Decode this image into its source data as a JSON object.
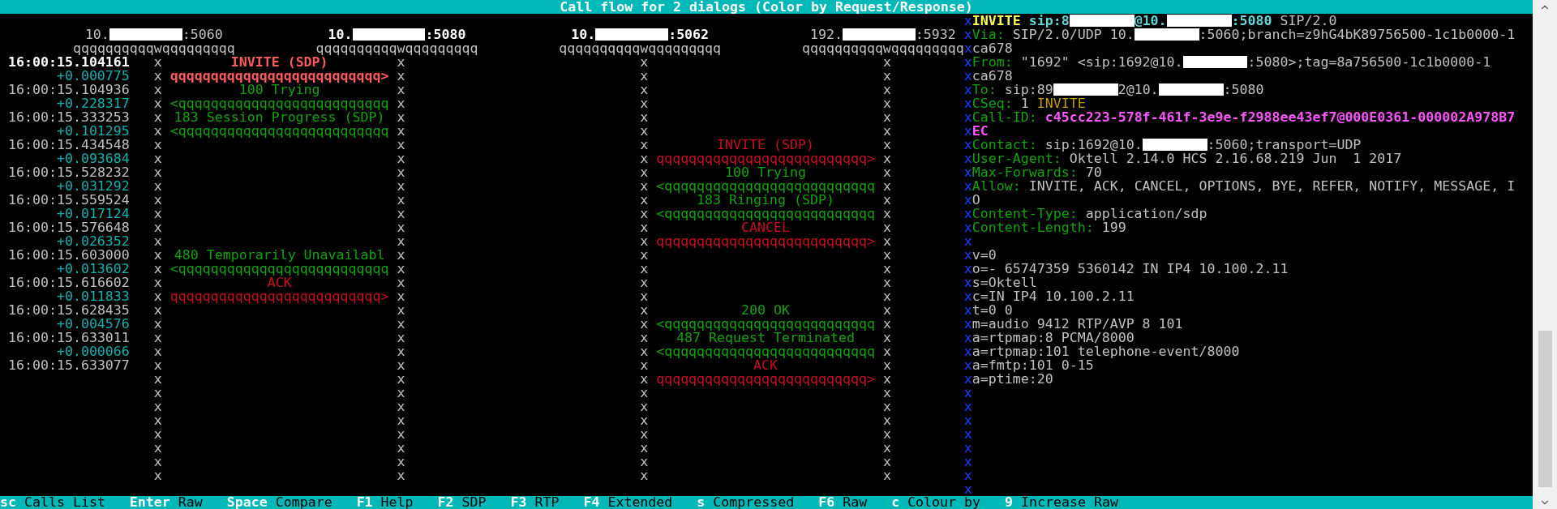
{
  "window": {
    "title": "Call flow for 2 dialogs (Color by Request/Response)"
  },
  "hosts": [
    {
      "prefix": "10.",
      "suffix": ":5060",
      "highlighted": false,
      "redacted": true,
      "rule": "qqqqqqqqqqwqqqqqqqqq",
      "lifeline": "xxxxxxxxxxxxxxxxxxxxxxxxxxxxxxx"
    },
    {
      "prefix": "10.",
      "suffix": ":5080",
      "highlighted": true,
      "redacted": true,
      "rule": "qqqqqqqqqqwqqqqqqqqq",
      "lifeline": "xxxxxxxxxxxxxxxxxxxxxxxxxxxxxxx"
    },
    {
      "prefix": "10.",
      "suffix": ":5062",
      "highlighted": true,
      "redacted": true,
      "rule": "qqqqqqqqqqwqqqqqqqqq",
      "lifeline": "xxxxxxxxxxxxxxxxxxxxxxxxxxxxxxx"
    },
    {
      "prefix": "192.",
      "suffix": ":5932",
      "highlighted": false,
      "redacted": true,
      "rule": "qqqqqqqqqqwqqqqqqqqq",
      "lifeline": "xxxxxxxxxxxxxxxxxxxxxxxxxxxxxxx"
    }
  ],
  "messages": [
    {
      "time": "16:00:15.104161",
      "delta": "+0.000775",
      "selected": true,
      "first_pair": {
        "kind": "request",
        "label": "INVITE (SDP)",
        "arrow": "qqqqqqqqqqqqqqqqqqqqqqqqqq>"
      }
    },
    {
      "time": "16:00:15.104936",
      "delta": "+0.228317",
      "selected": false,
      "first_pair": {
        "kind": "response",
        "label": "100 Trying",
        "arrow": "<qqqqqqqqqqqqqqqqqqqqqqqqqq"
      }
    },
    {
      "time": "16:00:15.333253",
      "delta": "+0.101295",
      "selected": false,
      "first_pair": {
        "kind": "response",
        "label": "183 Session Progress (SDP)",
        "arrow": "<qqqqqqqqqqqqqqqqqqqqqqqqqq"
      }
    },
    {
      "time": "16:00:15.434548",
      "delta": "+0.093684",
      "selected": false,
      "second_pair": {
        "kind": "request",
        "label": "INVITE (SDP)",
        "arrow": "qqqqqqqqqqqqqqqqqqqqqqqqqq>"
      }
    },
    {
      "time": "16:00:15.528232",
      "delta": "+0.031292",
      "selected": false,
      "second_pair": {
        "kind": "response",
        "label": "100 Trying",
        "arrow": "<qqqqqqqqqqqqqqqqqqqqqqqqqq"
      }
    },
    {
      "time": "16:00:15.559524",
      "delta": "+0.017124",
      "selected": false,
      "second_pair": {
        "kind": "response",
        "label": "183 Ringing (SDP)",
        "arrow": "<qqqqqqqqqqqqqqqqqqqqqqqqqq"
      }
    },
    {
      "time": "16:00:15.576648",
      "delta": "+0.026352",
      "selected": false,
      "second_pair": {
        "kind": "request",
        "label": "CANCEL",
        "arrow": "qqqqqqqqqqqqqqqqqqqqqqqqqq>"
      }
    },
    {
      "time": "16:00:15.603000",
      "delta": "+0.013602",
      "selected": false,
      "first_pair": {
        "kind": "response",
        "label": "480 Temporarily Unavailabl",
        "arrow": "<qqqqqqqqqqqqqqqqqqqqqqqqqq"
      }
    },
    {
      "time": "16:00:15.616602",
      "delta": "+0.011833",
      "selected": false,
      "first_pair": {
        "kind": "request",
        "label": "ACK",
        "arrow": "qqqqqqqqqqqqqqqqqqqqqqqqqq>"
      }
    },
    {
      "time": "16:00:15.628435",
      "delta": "+0.004576",
      "selected": false,
      "second_pair": {
        "kind": "response",
        "label": "200 OK",
        "arrow": "<qqqqqqqqqqqqqqqqqqqqqqqqqq"
      }
    },
    {
      "time": "16:00:15.633011",
      "delta": "+0.000066",
      "selected": false,
      "second_pair": {
        "kind": "response",
        "label": "487 Request Terminated",
        "arrow": "<qqqqqqqqqqqqqqqqqqqqqqqqqq"
      }
    },
    {
      "time": "16:00:15.633077",
      "selected": false,
      "second_pair": {
        "kind": "request",
        "label": "ACK",
        "arrow": "qqqqqqqqqqqqqqqqqqqqqqqqqq>"
      }
    }
  ],
  "detail": {
    "border": "xxxxxxxxxxxxxxxxxxxxxxxxxxxxxxxxxxx",
    "headers": [
      {
        "segments": [
          {
            "kind": "method",
            "text": "INVITE"
          },
          {
            "kind": "uri",
            "text": " sip:8"
          },
          {
            "kind": "redacted"
          },
          {
            "kind": "uri",
            "text": "@10."
          },
          {
            "kind": "redacted"
          },
          {
            "kind": "uri",
            "text": ":5080"
          },
          {
            "kind": "plain",
            "text": " SIP/2.0"
          }
        ]
      },
      {
        "segments": [
          {
            "kind": "header",
            "text": "Via:"
          },
          {
            "kind": "plain",
            "text": " SIP/2.0/UDP 10."
          },
          {
            "kind": "redacted"
          },
          {
            "kind": "plain",
            "text": ":5060;branch=z9hG4bK89756500-1c1b0000-1"
          }
        ]
      },
      {
        "segments": [
          {
            "kind": "plain",
            "text": "ca678"
          }
        ]
      },
      {
        "segments": [
          {
            "kind": "header",
            "text": "From:"
          },
          {
            "kind": "plain",
            "text": " \"1692\" <sip:1692@10."
          },
          {
            "kind": "redacted"
          },
          {
            "kind": "plain",
            "text": ":5080>;tag=8a756500-1c1b0000-1"
          }
        ]
      },
      {
        "segments": [
          {
            "kind": "plain",
            "text": "ca678"
          }
        ]
      },
      {
        "segments": [
          {
            "kind": "header",
            "text": "To:"
          },
          {
            "kind": "plain",
            "text": " sip:89"
          },
          {
            "kind": "redacted"
          },
          {
            "kind": "plain",
            "text": "2@10."
          },
          {
            "kind": "redacted"
          },
          {
            "kind": "plain",
            "text": ":5080"
          }
        ]
      },
      {
        "segments": [
          {
            "kind": "header",
            "text": "CSeq:"
          },
          {
            "kind": "plain",
            "text": " 1"
          },
          {
            "kind": "cseq",
            "text": " INVITE"
          }
        ]
      },
      {
        "segments": [
          {
            "kind": "header",
            "text": "Call-ID:"
          },
          {
            "kind": "callid",
            "text": " c45cc223-578f-461f-3e9e-f2988ee43ef7@000E0361-000002A978B7"
          }
        ]
      },
      {
        "segments": [
          {
            "kind": "callid",
            "text": "EC"
          }
        ]
      },
      {
        "segments": [
          {
            "kind": "header",
            "text": "Contact:"
          },
          {
            "kind": "plain",
            "text": " sip:1692@10."
          },
          {
            "kind": "redacted"
          },
          {
            "kind": "plain",
            "text": ":5060;transport=UDP"
          }
        ]
      },
      {
        "segments": [
          {
            "kind": "header",
            "text": "User-Agent:"
          },
          {
            "kind": "plain",
            "text": " Oktell 2.14.0 HCS 2.16.68.219 Jun  1 2017"
          }
        ]
      },
      {
        "segments": [
          {
            "kind": "header",
            "text": "Max-Forwards:"
          },
          {
            "kind": "plain",
            "text": " 70"
          }
        ]
      },
      {
        "segments": [
          {
            "kind": "header",
            "text": "Allow:"
          },
          {
            "kind": "plain",
            "text": " INVITE, ACK, CANCEL, OPTIONS, BYE, REFER, NOTIFY, MESSAGE, I"
          }
        ]
      },
      {
        "segments": [
          {
            "kind": "plain",
            "text": "O"
          }
        ]
      },
      {
        "segments": [
          {
            "kind": "header",
            "text": "Content-Type:"
          },
          {
            "kind": "plain",
            "text": " application/sdp"
          }
        ]
      },
      {
        "segments": [
          {
            "kind": "header",
            "text": "Content-Length:"
          },
          {
            "kind": "plain",
            "text": " 199"
          }
        ]
      }
    ],
    "sdp": [
      "v=0",
      "o=- 65747359 5360142 IN IP4 10.100.2.11",
      "s=Oktell",
      "c=IN IP4 10.100.2.11",
      "t=0 0",
      "m=audio 9412 RTP/AVP 8 101",
      "a=rtpmap:8 PCMA/8000",
      "a=rtpmap:101 telephone-event/8000",
      "a=fmtp:101 0-15",
      "a=ptime:20"
    ]
  },
  "status_bar": [
    {
      "key": "sc",
      "label": "Calls List"
    },
    {
      "key": "Enter",
      "label": "Raw"
    },
    {
      "key": "Space",
      "label": "Compare"
    },
    {
      "key": "F1",
      "label": "Help"
    },
    {
      "key": "F2",
      "label": "SDP"
    },
    {
      "key": "F3",
      "label": "RTP"
    },
    {
      "key": "F4",
      "label": "Extended"
    },
    {
      "key": "s",
      "label": "Compressed"
    },
    {
      "key": "F6",
      "label": "Raw"
    },
    {
      "key": "c",
      "label": "Colour by"
    },
    {
      "key": "9",
      "label": "Increase Raw"
    }
  ]
}
